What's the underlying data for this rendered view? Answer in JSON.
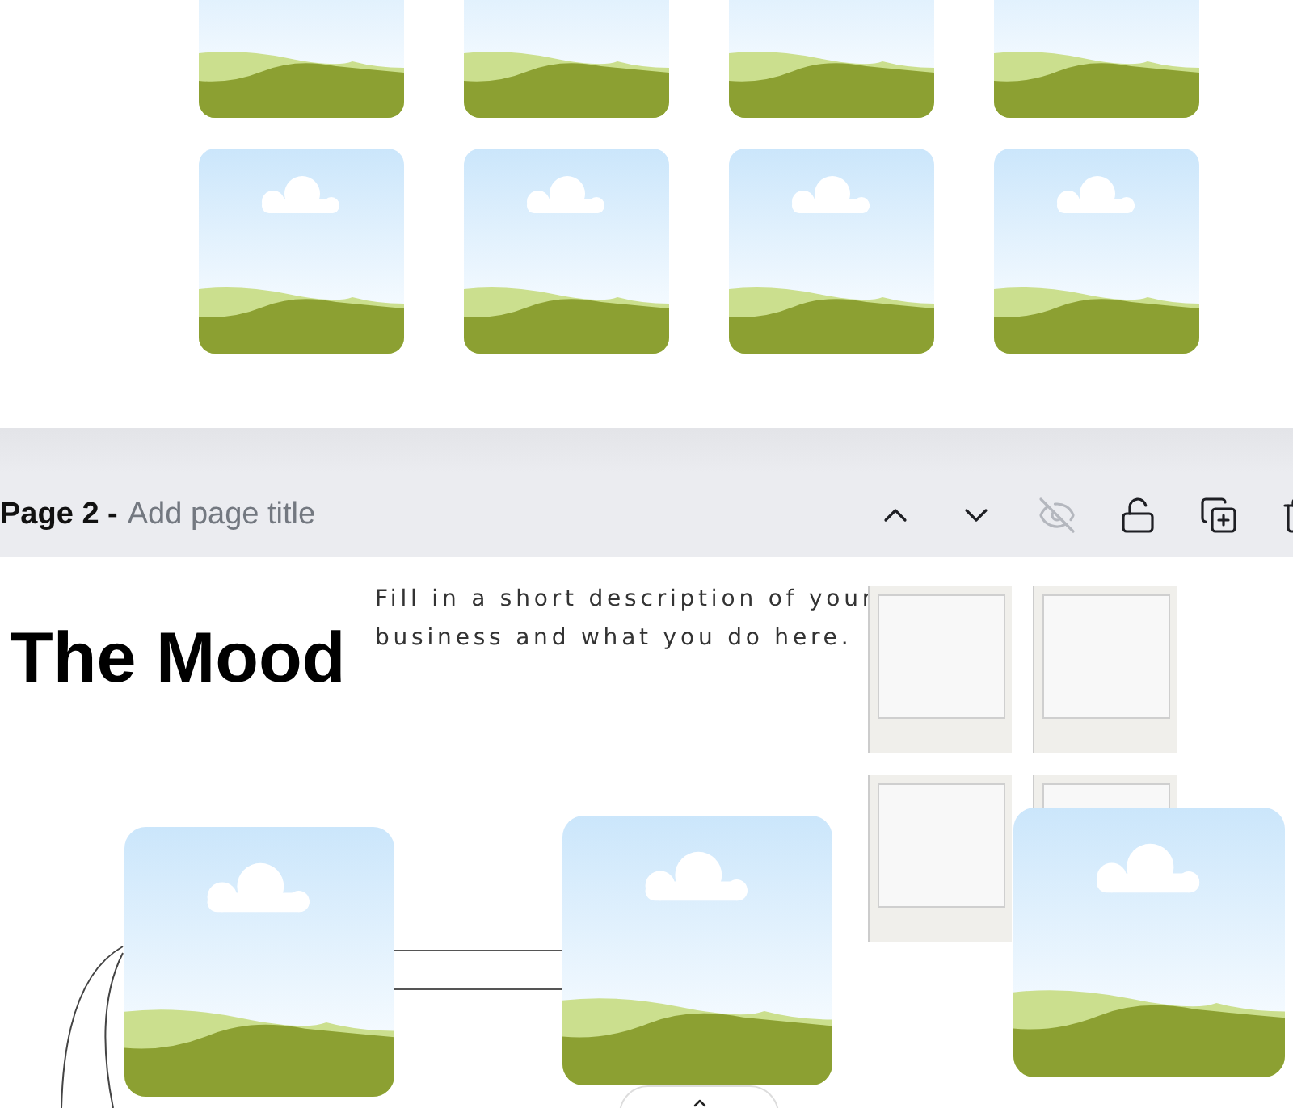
{
  "page_header": {
    "page_label": "Page 2 -",
    "title_placeholder": "Add page title",
    "actions": [
      {
        "kind": "up",
        "disabled": false
      },
      {
        "kind": "down",
        "disabled": false
      },
      {
        "kind": "hide",
        "disabled": true
      },
      {
        "kind": "unlock",
        "disabled": false
      },
      {
        "kind": "duplicate",
        "disabled": false
      },
      {
        "kind": "delete",
        "disabled": false
      }
    ]
  },
  "canvas": {
    "heading": "The Mood",
    "description": "Fill in a short description of your business and what you do here.",
    "frames": [
      {
        "kind": "frame"
      },
      {
        "kind": "frame"
      },
      {
        "kind": "frame"
      },
      {
        "kind": "frame"
      }
    ]
  }
}
